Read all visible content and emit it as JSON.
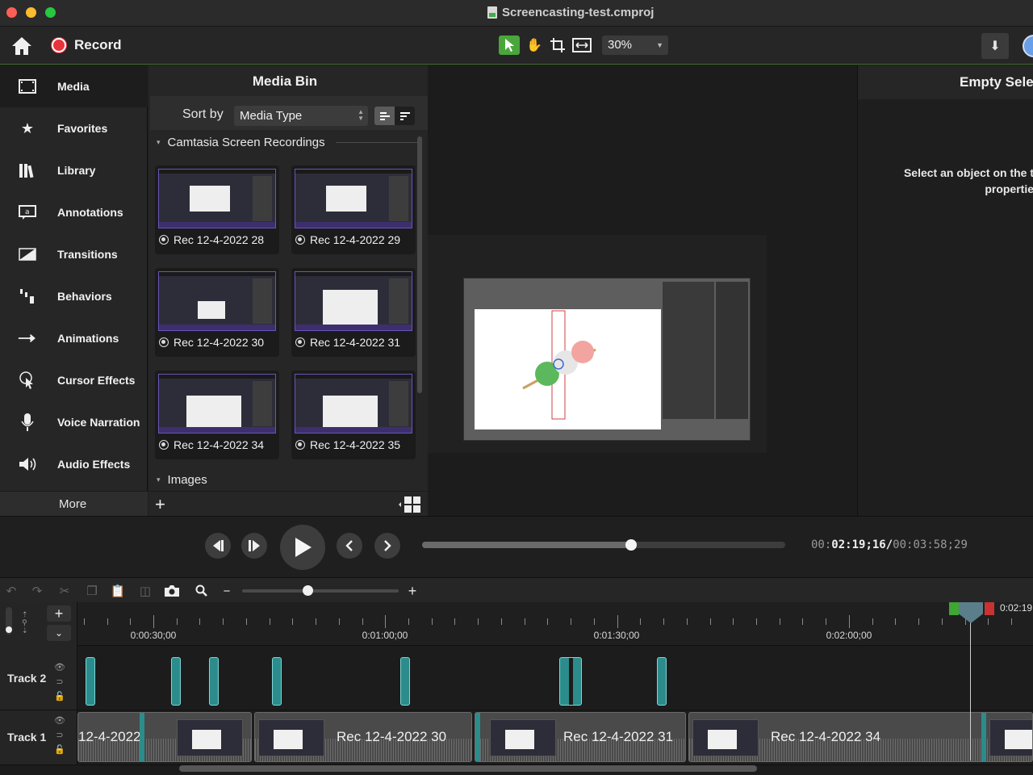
{
  "window": {
    "title": "Screencasting-test.cmproj"
  },
  "toolbar": {
    "record_label": "Record",
    "zoom_value": "30%"
  },
  "sidebar": {
    "items": [
      {
        "label": "Media",
        "icon": "filmstrip-icon"
      },
      {
        "label": "Favorites",
        "icon": "star-icon"
      },
      {
        "label": "Library",
        "icon": "library-icon"
      },
      {
        "label": "Annotations",
        "icon": "annotation-icon"
      },
      {
        "label": "Transitions",
        "icon": "transition-icon"
      },
      {
        "label": "Behaviors",
        "icon": "behaviors-icon"
      },
      {
        "label": "Animations",
        "icon": "animation-arrow-icon"
      },
      {
        "label": "Cursor Effects",
        "icon": "cursor-icon"
      },
      {
        "label": "Voice Narration",
        "icon": "microphone-icon"
      },
      {
        "label": "Audio Effects",
        "icon": "speaker-icon"
      }
    ],
    "more_label": "More"
  },
  "media_bin": {
    "title": "Media Bin",
    "sort_label": "Sort by",
    "sort_value": "Media Type",
    "group_recordings": "Camtasia Screen Recordings",
    "group_images": "Images",
    "recordings": [
      "Rec 12-4-2022 28",
      "Rec 12-4-2022 29",
      "Rec 12-4-2022 30",
      "Rec 12-4-2022 31",
      "Rec 12-4-2022 34",
      "Rec 12-4-2022 35"
    ]
  },
  "properties": {
    "title": "Empty Sele",
    "message_line1": "Select an object on the t",
    "message_line2": "propertie"
  },
  "playback": {
    "time_prefix": "00:",
    "time_current": "02:19;16",
    "time_sep": "/",
    "time_total": "00:03:58;29",
    "progress": 0.576
  },
  "timeline": {
    "zoom_level": 0.42,
    "ticks": [
      "0:00:30;00",
      "0:01:00;00",
      "0:01:30;00",
      "0:02:00;00"
    ],
    "playhead_time": "0:02:19",
    "tracks": [
      {
        "name": "Track 2"
      },
      {
        "name": "Track 1"
      }
    ],
    "clips": [
      "12-4-2022",
      "Rec 12-4-2022 30",
      "Rec 12-4-2022 31",
      "Rec 12-4-2022 34"
    ]
  },
  "colors": {
    "accent_green": "#4aa63a",
    "record_red": "#e8333c",
    "track_teal": "#2c8c8c"
  }
}
